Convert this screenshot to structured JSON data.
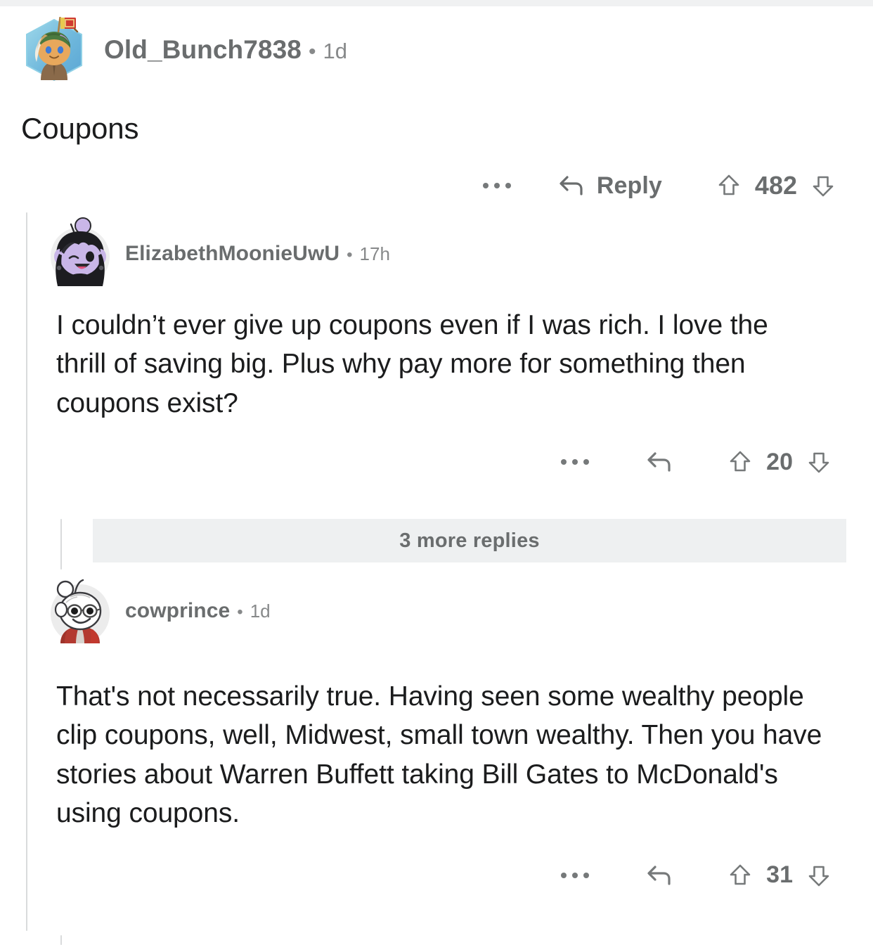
{
  "app": {
    "platform": "reddit-comments",
    "background_color": "#ffffff",
    "status_strip_color": "#f0f1f2",
    "thread_line_color": "#d9dbdc",
    "muted_text_color": "#6a6d6e",
    "body_text_color": "#1b1c1d",
    "more_replies_bg": "#eef0f1"
  },
  "comments": [
    {
      "id": "root",
      "depth": 0,
      "author": "Old_Bunch7838",
      "separator": "•",
      "timestamp": "1d",
      "body": "Coupons",
      "avatar": {
        "name": "avatar-old-bunch7838",
        "style": "hexagon-snoo",
        "skin": "#e8a85c",
        "headwrap": "#4b7a3f",
        "hex_bg": "#7cc0dd",
        "flag": "#cf3a30",
        "flag_pole": "#b08040"
      },
      "actions": {
        "overflow_label": "more-options",
        "reply_label": "Reply",
        "show_reply_label": true,
        "upvote_label": "upvote",
        "downvote_label": "downvote",
        "score": "482"
      }
    },
    {
      "id": "reply-1",
      "depth": 1,
      "author": "ElizabethMoonieUwU",
      "separator": "•",
      "timestamp": "17h",
      "body": "I couldn’t ever give up coupons even if I was rich. I love the thrill of saving big. Plus why pay more for something then coupons exist?",
      "avatar": {
        "name": "avatar-elizabethmoonieuwu",
        "style": "circle-snoo",
        "skin": "#c9b6e8",
        "hair": "#1c1c20",
        "shirt": "#1c1c20",
        "bg": "#eeeeee",
        "mouth": "#e0507a"
      },
      "actions": {
        "overflow_label": "more-options",
        "reply_label": "reply",
        "show_reply_label": false,
        "upvote_label": "upvote",
        "downvote_label": "downvote",
        "score": "20"
      }
    },
    {
      "id": "reply-2",
      "depth": 1,
      "author": "cowprince",
      "separator": "•",
      "timestamp": "1d",
      "body": "That's not necessarily true. Having seen some wealthy people clip coupons, well, Midwest, small town wealthy. Then you have stories about Warren Buffett taking Bill Gates to McDonald's using coupons.",
      "avatar": {
        "name": "avatar-cowprince",
        "style": "circle-snoo",
        "skin": "#ffffff",
        "outline": "#3a3a3a",
        "scarf": "#b33a30",
        "glasses": "#4a4a4a",
        "bg": "#ececec"
      },
      "actions": {
        "overflow_label": "more-options",
        "reply_label": "reply",
        "show_reply_label": false,
        "upvote_label": "upvote",
        "downvote_label": "downvote",
        "score": "31"
      }
    }
  ],
  "more_replies": {
    "label": "3 more replies",
    "count": 3
  }
}
